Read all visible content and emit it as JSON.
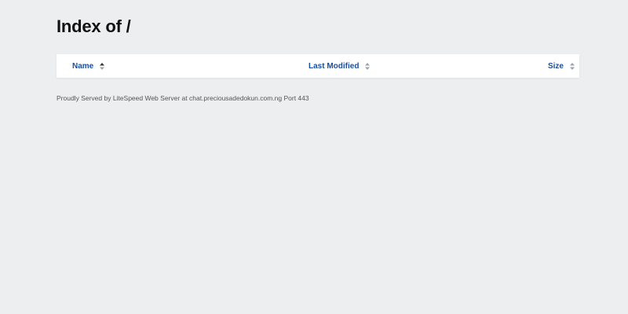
{
  "page": {
    "title": "Index of /"
  },
  "table": {
    "columns": [
      {
        "label": "Name",
        "sort_icon": "sort-ascending-icon"
      },
      {
        "label": "Last Modified",
        "sort_icon": "sort-neutral-icon"
      },
      {
        "label": "Size",
        "sort_icon": "sort-neutral-icon"
      }
    ],
    "rows": []
  },
  "footer": {
    "text": "Proudly Served by LiteSpeed Web Server at chat.preciousadedokun.com.ng Port 443"
  },
  "colors": {
    "background": "#eceef0",
    "link": "#1a4fa0",
    "card": "#ffffff"
  }
}
